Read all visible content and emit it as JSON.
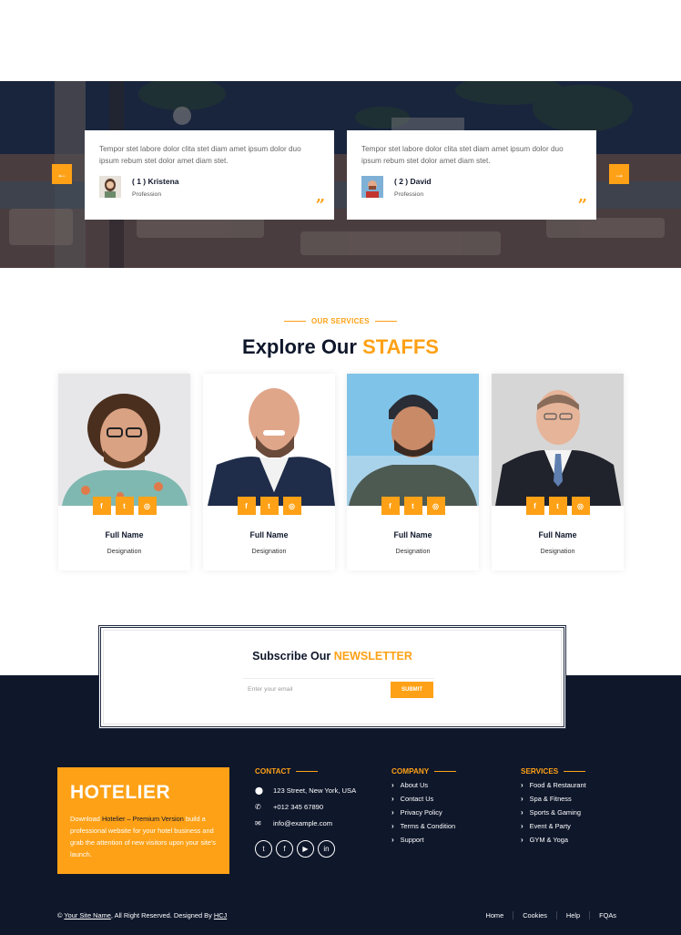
{
  "testimonials": {
    "prev_arrow": "←",
    "next_arrow": "→",
    "items": [
      {
        "text": "Tempor stet labore dolor clita stet diam amet ipsum dolor duo ipsum rebum stet dolor amet diam stet.",
        "name": "( 1 ) Kristena",
        "profession": "Profession"
      },
      {
        "text": "Tempor stet labore dolor clita stet diam amet ipsum dolor duo ipsum rebum stet dolor amet diam stet.",
        "name": "( 2 ) David",
        "profession": "Profession"
      }
    ],
    "quote_glyph": "”"
  },
  "services": {
    "label": "OUR SERVICES",
    "title_prefix": "Explore Our",
    "title_highlight": "STAFFS",
    "staff": [
      {
        "name": "Full Name",
        "designation": "Designation"
      },
      {
        "name": "Full Name",
        "designation": "Designation"
      },
      {
        "name": "Full Name",
        "designation": "Designation"
      },
      {
        "name": "Full Name",
        "designation": "Designation"
      }
    ],
    "social_icons": [
      "f",
      "t",
      "ig"
    ]
  },
  "newsletter": {
    "title_prefix": "Subscribe Our",
    "title_highlight": "NEWSLETTER",
    "placeholder": "Enter your email",
    "button": "SUBMIT"
  },
  "footer": {
    "brand": "HOTELIER",
    "about_pre": "Download",
    "about_link": "Hotelier – Premium Version",
    "about_post": "build a professional website for your hotel business and grab the attention of new visitors upon your site's launch.",
    "contact": {
      "heading": "CONTACT",
      "address": "123 Street, New York, USA",
      "phone": "+012 345 67890",
      "email": "info@example.com"
    },
    "company": {
      "heading": "COMPANY",
      "links": [
        "About Us",
        "Contact Us",
        "Privacy Policy",
        "Terms & Condition",
        "Support"
      ]
    },
    "services": {
      "heading": "SERVICES",
      "links": [
        "Food & Restaurant",
        "Spa & Fitness",
        "Sports & Gaming",
        "Event & Party",
        "GYM & Yoga"
      ]
    },
    "copyright_pre": "©",
    "site_name": "Your Site Name",
    "copyright_mid": ", All Right Reserved. Designed By",
    "designer": "HCJ",
    "menu": [
      "Home",
      "Cookies",
      "Help",
      "FQAs"
    ]
  },
  "colors": {
    "accent": "#fea116",
    "dark": "#0f172b"
  }
}
